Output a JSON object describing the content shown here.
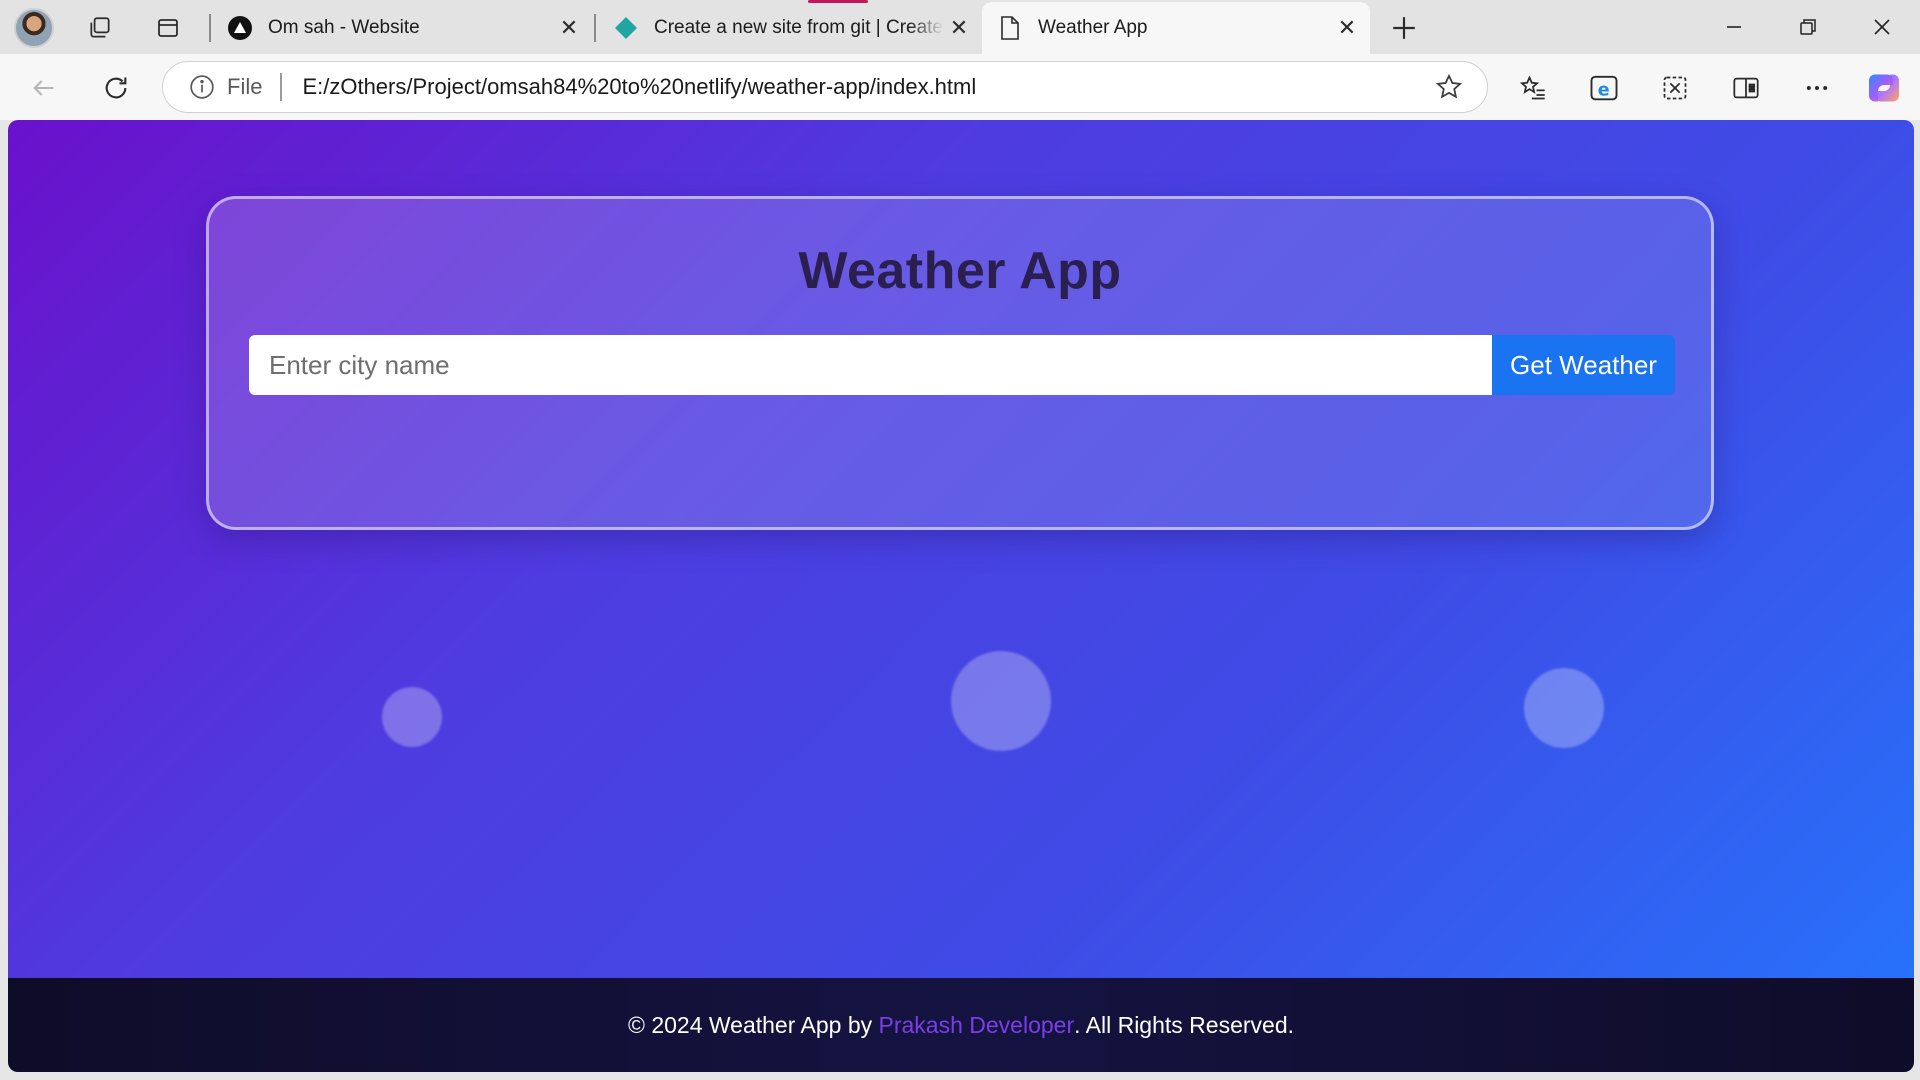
{
  "browser": {
    "tabs": [
      {
        "title": "Om sah - Website",
        "icon": "triangle-logo-icon"
      },
      {
        "title": "Create a new site from git | Create",
        "icon": "netlify-diamond-icon"
      },
      {
        "title": "Weather App",
        "icon": "page-icon",
        "active": true
      }
    ],
    "address": {
      "scheme": "File",
      "url": "E:/zOthers/Project/omsah84%20to%20netlify/weather-app/index.html"
    },
    "close_glyph": "✕"
  },
  "page": {
    "title": "Weather App",
    "search": {
      "placeholder": "Enter city name",
      "value": "",
      "button_label": "Get Weather"
    },
    "footer": {
      "prefix": "© 2024 Weather App by ",
      "author": "Prakash Developer",
      "suffix": ". All Rights Reserved."
    }
  },
  "colors": {
    "gradient_start": "#6a11cb",
    "gradient_end": "#2575fc",
    "button": "#1a73f0",
    "footer_bg": "#0f0c29",
    "footer_link": "#7a3ee8"
  }
}
